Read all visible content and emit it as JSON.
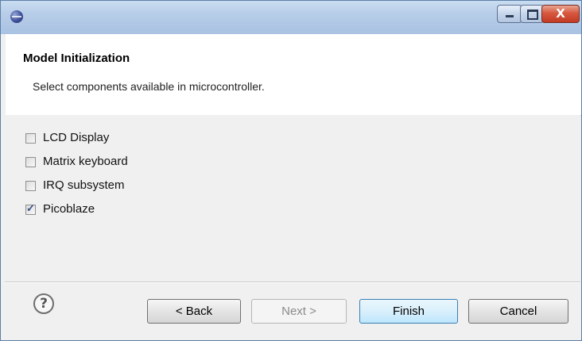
{
  "window": {
    "title": "",
    "controls": {
      "minimize": "minimize",
      "maximize": "maximize",
      "close": "X"
    }
  },
  "header": {
    "title": "Model Initialization",
    "description": "Select components available in microcontroller."
  },
  "components": [
    {
      "label": "LCD Display",
      "checked": false
    },
    {
      "label": "Matrix keyboard",
      "checked": false
    },
    {
      "label": "IRQ subsystem",
      "checked": false
    },
    {
      "label": "Picoblaze",
      "checked": true
    }
  ],
  "footer": {
    "help_glyph": "?",
    "back_label": "< Back",
    "next_label": "Next >",
    "finish_label": "Finish",
    "cancel_label": "Cancel",
    "next_enabled": false
  },
  "icons": {
    "app": "eclipse-icon",
    "help": "help-icon"
  }
}
